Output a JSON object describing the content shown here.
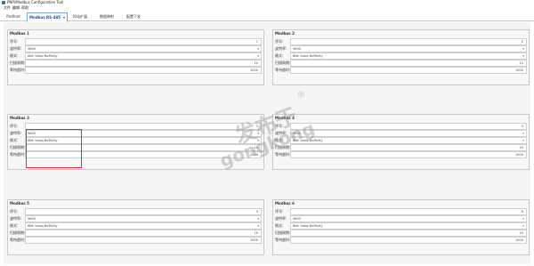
{
  "window": {
    "title": "PNPi/Modbus Configuration Tool"
  },
  "menu": [
    "文件",
    "编辑",
    "帮助"
  ],
  "tabs": [
    {
      "label": "Profinet",
      "active": false
    },
    {
      "label": "Modbus RS-485",
      "active": true
    },
    {
      "label": "IO站扩展",
      "active": false
    },
    {
      "label": "数据映射",
      "active": false
    },
    {
      "label": "配置下发",
      "active": false
    }
  ],
  "groups": [
    {
      "title": "Modbus 1",
      "fields": [
        {
          "label": "序号:",
          "value": "1",
          "kind": "number"
        },
        {
          "label": "波特率:",
          "value": "9600",
          "kind": "select"
        },
        {
          "label": "格式:",
          "value": "8bit 1stop NoParity",
          "kind": "select"
        },
        {
          "label": "扫描周期:",
          "value": "10",
          "kind": "number"
        },
        {
          "label": "等待超时:",
          "value": "1000",
          "kind": "number"
        }
      ]
    },
    {
      "title": "Modbus 2",
      "fields": [
        {
          "label": "序号:",
          "value": "2",
          "kind": "number"
        },
        {
          "label": "波特率:",
          "value": "9600",
          "kind": "select"
        },
        {
          "label": "格式:",
          "value": "8bit 1stop NoParity",
          "kind": "select"
        },
        {
          "label": "扫描周期:",
          "value": "10",
          "kind": "number"
        },
        {
          "label": "等待超时:",
          "value": "1000",
          "kind": "number"
        }
      ]
    },
    {
      "title": "Modbus 3",
      "fields": [
        {
          "label": "序号:",
          "value": "3",
          "kind": "number"
        },
        {
          "label": "波特率:",
          "value": "9600",
          "kind": "select"
        },
        {
          "label": "格式:",
          "value": "8bit 1stop NoParity",
          "kind": "select"
        },
        {
          "label": "扫描周期:",
          "value": "10",
          "kind": "number"
        },
        {
          "label": "等待超时:",
          "value": "1000",
          "kind": "number"
        }
      ]
    },
    {
      "title": "Modbus 4",
      "fields": [
        {
          "label": "序号:",
          "value": "4",
          "kind": "number"
        },
        {
          "label": "波特率:",
          "value": "9600",
          "kind": "select"
        },
        {
          "label": "格式:",
          "value": "8bit 1stop NoParity",
          "kind": "select"
        },
        {
          "label": "扫描周期:",
          "value": "10",
          "kind": "number"
        },
        {
          "label": "等待超时:",
          "value": "1000",
          "kind": "number"
        }
      ]
    },
    {
      "title": "Modbus 5",
      "fields": [
        {
          "label": "序号:",
          "value": "5",
          "kind": "number"
        },
        {
          "label": "波特率:",
          "value": "9600",
          "kind": "select"
        },
        {
          "label": "格式:",
          "value": "8bit 1stop NoParity",
          "kind": "select"
        },
        {
          "label": "扫描周期:",
          "value": "10",
          "kind": "number"
        },
        {
          "label": "等待超时:",
          "value": "1000",
          "kind": "number"
        }
      ]
    },
    {
      "title": "Modbus 6",
      "fields": [
        {
          "label": "序号:",
          "value": "6",
          "kind": "number"
        },
        {
          "label": "波特率:",
          "value": "9600",
          "kind": "select"
        },
        {
          "label": "格式:",
          "value": "8bit 1stop NoParity",
          "kind": "select"
        },
        {
          "label": "扫描周期:",
          "value": "10",
          "kind": "number"
        },
        {
          "label": "等待超时:",
          "value": "1000",
          "kind": "number"
        }
      ]
    }
  ],
  "watermark": {
    "line1": "发布于",
    "line2": "gongkong",
    "mark": "®"
  },
  "colors": {
    "highlight": "#d9302a",
    "accent": "#1f4f9a"
  },
  "icons": {
    "app": "app-icon",
    "dropdown": "chevron-down-icon"
  }
}
